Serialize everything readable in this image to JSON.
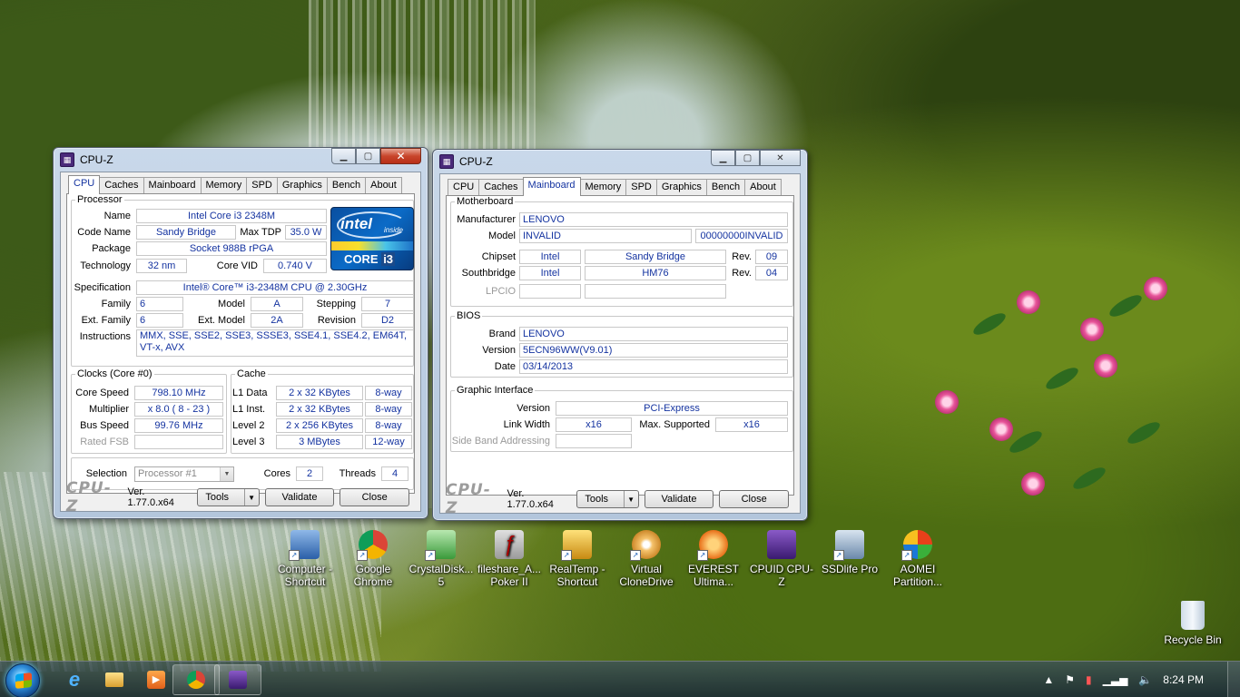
{
  "window_left": {
    "title": "CPU-Z",
    "tabs": [
      "CPU",
      "Caches",
      "Mainboard",
      "Memory",
      "SPD",
      "Graphics",
      "Bench",
      "About"
    ],
    "processor": {
      "legend": "Processor",
      "name_label": "Name",
      "name": "Intel Core i3 2348M",
      "code_name_label": "Code Name",
      "code_name": "Sandy Bridge",
      "max_tdp_label": "Max TDP",
      "max_tdp": "35.0 W",
      "package_label": "Package",
      "package": "Socket 988B rPGA",
      "technology_label": "Technology",
      "technology": "32 nm",
      "core_vid_label": "Core VID",
      "core_vid": "0.740 V",
      "specification_label": "Specification",
      "specification": "Intel® Core™ i3-2348M CPU @ 2.30GHz",
      "family_label": "Family",
      "family": "6",
      "model_label": "Model",
      "model": "A",
      "stepping_label": "Stepping",
      "stepping": "7",
      "ext_family_label": "Ext. Family",
      "ext_family": "6",
      "ext_model_label": "Ext. Model",
      "ext_model": "2A",
      "revision_label": "Revision",
      "revision": "D2",
      "instructions_label": "Instructions",
      "instructions": "MMX, SSE, SSE2, SSE3, SSSE3, SSE4.1, SSE4.2, EM64T, VT-x, AVX",
      "logo_word": "intel",
      "logo_inside": "inside",
      "logo_core": "CORE",
      "logo_i3": "i3"
    },
    "clocks": {
      "legend": "Clocks (Core #0)",
      "core_speed_label": "Core Speed",
      "core_speed": "798.10 MHz",
      "multiplier_label": "Multiplier",
      "multiplier": "x 8.0 ( 8 - 23 )",
      "bus_speed_label": "Bus Speed",
      "bus_speed": "99.76 MHz",
      "rated_fsb_label": "Rated FSB",
      "rated_fsb": ""
    },
    "cache": {
      "legend": "Cache",
      "l1d_label": "L1 Data",
      "l1d": "2 x 32 KBytes",
      "l1d_way": "8-way",
      "l1i_label": "L1 Inst.",
      "l1i": "2 x 32 KBytes",
      "l1i_way": "8-way",
      "l2_label": "Level 2",
      "l2": "2 x 256 KBytes",
      "l2_way": "8-way",
      "l3_label": "Level 3",
      "l3": "3 MBytes",
      "l3_way": "12-way"
    },
    "selection_label": "Selection",
    "selection": "Processor #1",
    "cores_label": "Cores",
    "cores": "2",
    "threads_label": "Threads",
    "threads": "4",
    "brand": "CPU-Z",
    "version": "Ver. 1.77.0.x64",
    "tools_label": "Tools",
    "validate_label": "Validate",
    "close_label": "Close"
  },
  "window_right": {
    "title": "CPU-Z",
    "tabs": [
      "CPU",
      "Caches",
      "Mainboard",
      "Memory",
      "SPD",
      "Graphics",
      "Bench",
      "About"
    ],
    "motherboard": {
      "legend": "Motherboard",
      "manufacturer_label": "Manufacturer",
      "manufacturer": "LENOVO",
      "model_label": "Model",
      "model": "INVALID",
      "model2": "00000000INVALID",
      "chipset_label": "Chipset",
      "chipset_vendor": "Intel",
      "chipset_name": "Sandy Bridge",
      "chipset_rev_label": "Rev.",
      "chipset_rev": "09",
      "southbridge_label": "Southbridge",
      "southbridge_vendor": "Intel",
      "southbridge_name": "HM76",
      "southbridge_rev_label": "Rev.",
      "southbridge_rev": "04",
      "lpcio_label": "LPCIO"
    },
    "bios": {
      "legend": "BIOS",
      "brand_label": "Brand",
      "brand": "LENOVO",
      "version_label": "Version",
      "version": "5ECN96WW(V9.01)",
      "date_label": "Date",
      "date": "03/14/2013"
    },
    "graphic": {
      "legend": "Graphic Interface",
      "version_label": "Version",
      "version": "PCI-Express",
      "link_width_label": "Link Width",
      "link_width": "x16",
      "max_supported_label": "Max. Supported",
      "max_supported": "x16",
      "side_band_label": "Side Band Addressing"
    },
    "brand": "CPU-Z",
    "version": "Ver. 1.77.0.x64",
    "tools_label": "Tools",
    "validate_label": "Validate",
    "close_label": "Close"
  },
  "desktop_icons": [
    {
      "label": "Computer - Shortcut",
      "icon": "computer-icon"
    },
    {
      "label": "Google Chrome",
      "icon": "chrome-icon"
    },
    {
      "label": "CrystalDisk... 5",
      "icon": "crystaldisk-icon"
    },
    {
      "label": "fileshare_A... Poker II",
      "icon": "flash-icon"
    },
    {
      "label": "RealTemp - Shortcut",
      "icon": "realtemp-icon"
    },
    {
      "label": "Virtual CloneDrive",
      "icon": "clonedrive-icon"
    },
    {
      "label": "EVEREST Ultima...",
      "icon": "everest-icon"
    },
    {
      "label": "CPUID CPU-Z",
      "icon": "cpuz-icon"
    },
    {
      "label": "SSDlife Pro",
      "icon": "ssdlife-icon"
    },
    {
      "label": "AOMEI Partition...",
      "icon": "aomei-icon"
    }
  ],
  "recycle_bin": "Recycle Bin",
  "taskbar": {
    "clock": "8:24 PM",
    "items": [
      "ie-icon",
      "explorer-icon",
      "media-player-icon",
      "chrome-icon",
      "cpuz-icon"
    ]
  }
}
